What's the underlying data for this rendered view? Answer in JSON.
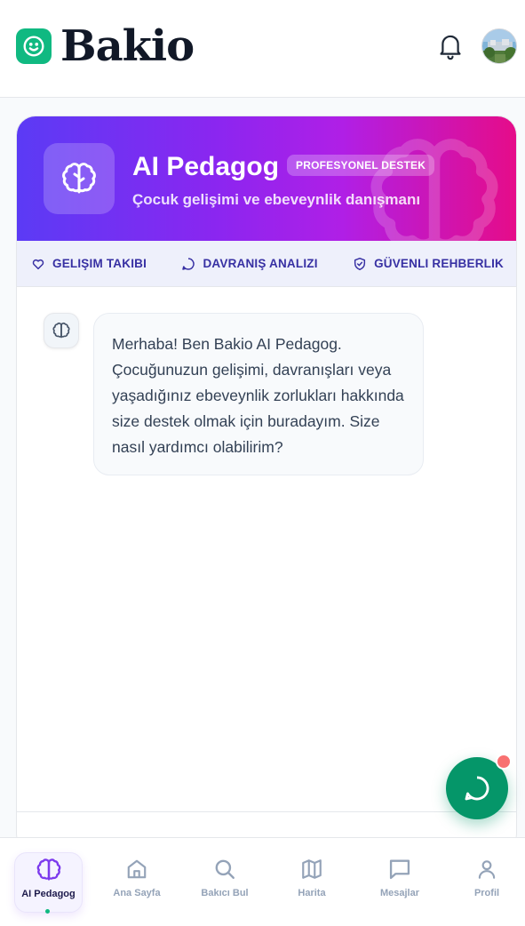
{
  "header": {
    "logo_text": "Bakio",
    "notifications_icon": "bell-icon",
    "avatar_icon": "user-avatar"
  },
  "hero": {
    "title": "AI Pedagog",
    "badge": "PROFESYONEL DESTEK",
    "subtitle": "Çocuk gelişimi ve ebeveynlik danışmanı",
    "icon": "brain-icon"
  },
  "features": [
    {
      "label": "GELIŞIM TAKIBI",
      "icon": "heart-icon"
    },
    {
      "label": "DAVRANIŞ ANALIZI",
      "icon": "chat-icon"
    },
    {
      "label": "GÜVENLI REHBERLIK",
      "icon": "shield-check-icon"
    }
  ],
  "chat": {
    "messages": [
      {
        "sender": "bot",
        "text": "Merhaba! Ben Bakio AI Pedagog. Çocuğunuzun gelişimi, davranışları veya yaşadığınız ebeveynlik zorlukları hakkında size destek olmak için buradayım. Size nasıl yardımcı olabilirim?"
      }
    ]
  },
  "fab": {
    "icon": "chat-bubble-icon"
  },
  "bottom_nav": {
    "items": [
      {
        "label": "AI Pedagog",
        "icon": "brain-icon",
        "active": true
      },
      {
        "label": "Ana Sayfa",
        "icon": "home-icon"
      },
      {
        "label": "Bakıcı Bul",
        "icon": "search-icon"
      },
      {
        "label": "Harita",
        "icon": "map-icon"
      },
      {
        "label": "Mesajlar",
        "icon": "message-icon"
      },
      {
        "label": "Profil",
        "icon": "user-icon"
      }
    ]
  },
  "colors": {
    "brand_green": "#10b981",
    "hero_gradient_start": "#5b3bf5",
    "hero_gradient_end": "#e60c88",
    "feature_text": "#3730a3",
    "fab": "#059669",
    "notification_dot": "#f87171"
  }
}
